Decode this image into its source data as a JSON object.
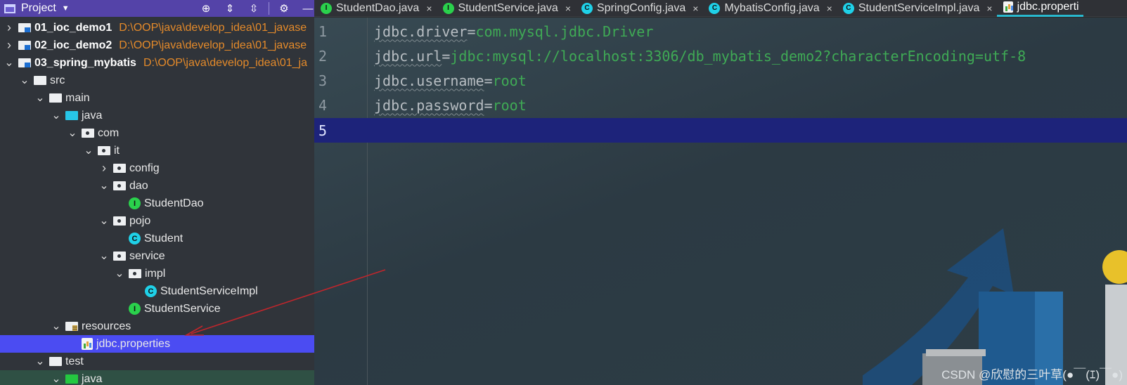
{
  "project_panel": {
    "title": "Project",
    "tool_icons": [
      "target-icon",
      "expand-all-icon",
      "collapse-all-icon",
      "gear-icon",
      "minimize-icon"
    ],
    "tree": [
      {
        "label": "01_ioc_demo1",
        "path": "D:\\OOP\\java\\develop_idea\\01_javase",
        "icon": "module",
        "chevron": "right",
        "bold": true
      },
      {
        "label": "02_ioc_demo2",
        "path": "D:\\OOP\\java\\develop_idea\\01_javase",
        "icon": "module",
        "chevron": "right",
        "bold": true
      },
      {
        "label": "03_spring_mybatis",
        "path": "D:\\OOP\\java\\develop_idea\\01_ja",
        "icon": "module",
        "chevron": "down",
        "bold": true
      },
      {
        "label": "src",
        "icon": "folder",
        "chevron": "down"
      },
      {
        "label": "main",
        "icon": "folder",
        "chevron": "down"
      },
      {
        "label": "java",
        "icon": "source-folder",
        "chevron": "down"
      },
      {
        "label": "com",
        "icon": "package",
        "chevron": "down"
      },
      {
        "label": "it",
        "icon": "package",
        "chevron": "down"
      },
      {
        "label": "config",
        "icon": "package",
        "chevron": "right"
      },
      {
        "label": "dao",
        "icon": "package",
        "chevron": "down"
      },
      {
        "label": "StudentDao",
        "icon": "interface"
      },
      {
        "label": "pojo",
        "icon": "package",
        "chevron": "down"
      },
      {
        "label": "Student",
        "icon": "class"
      },
      {
        "label": "service",
        "icon": "package",
        "chevron": "down"
      },
      {
        "label": "impl",
        "icon": "package",
        "chevron": "down"
      },
      {
        "label": "StudentServiceImpl",
        "icon": "class"
      },
      {
        "label": "StudentService",
        "icon": "interface"
      },
      {
        "label": "resources",
        "icon": "resources-folder",
        "chevron": "down"
      },
      {
        "label": "jdbc.properties",
        "icon": "properties",
        "selected": true
      },
      {
        "label": "test",
        "icon": "folder",
        "chevron": "down"
      },
      {
        "label": "java",
        "icon": "test-source-folder",
        "chevron": "down"
      }
    ]
  },
  "tabs": [
    {
      "label": "StudentDao.java",
      "icon": "interface",
      "glyph": "I"
    },
    {
      "label": "StudentService.java",
      "icon": "interface",
      "glyph": "I"
    },
    {
      "label": "SpringConfig.java",
      "icon": "class",
      "glyph": "C"
    },
    {
      "label": "MybatisConfig.java",
      "icon": "class",
      "glyph": "C"
    },
    {
      "label": "StudentServiceImpl.java",
      "icon": "class",
      "glyph": "C"
    },
    {
      "label": "jdbc.properti",
      "icon": "properties",
      "active": true
    }
  ],
  "tab_close_glyph": "×",
  "editor": {
    "lines": [
      {
        "num": "1",
        "key": "jdbc.driver",
        "eq": "=",
        "value": "com.mysql.jdbc.Driver"
      },
      {
        "num": "2",
        "key": "jdbc.url",
        "eq": "=",
        "value": "jdbc:mysql://localhost:3306/db_mybatis_demo2?characterEncoding=utf-8"
      },
      {
        "num": "3",
        "key": "jdbc.username",
        "eq": "=",
        "value": "root"
      },
      {
        "num": "4",
        "key": "jdbc.password",
        "eq": "=",
        "value": "root"
      },
      {
        "num": "5",
        "key": "",
        "eq": "",
        "value": "",
        "current": true
      }
    ]
  },
  "watermark": "CSDN @欣慰的三叶草(●￣(ｴ)￣●)",
  "colors": {
    "header_bg": "#5443a8",
    "selection": "#4b4cf2",
    "current_line": "#1d237a",
    "property_value": "#3faa55",
    "path_text": "#e48a2a",
    "annotation_arrow": "#c0262c"
  }
}
